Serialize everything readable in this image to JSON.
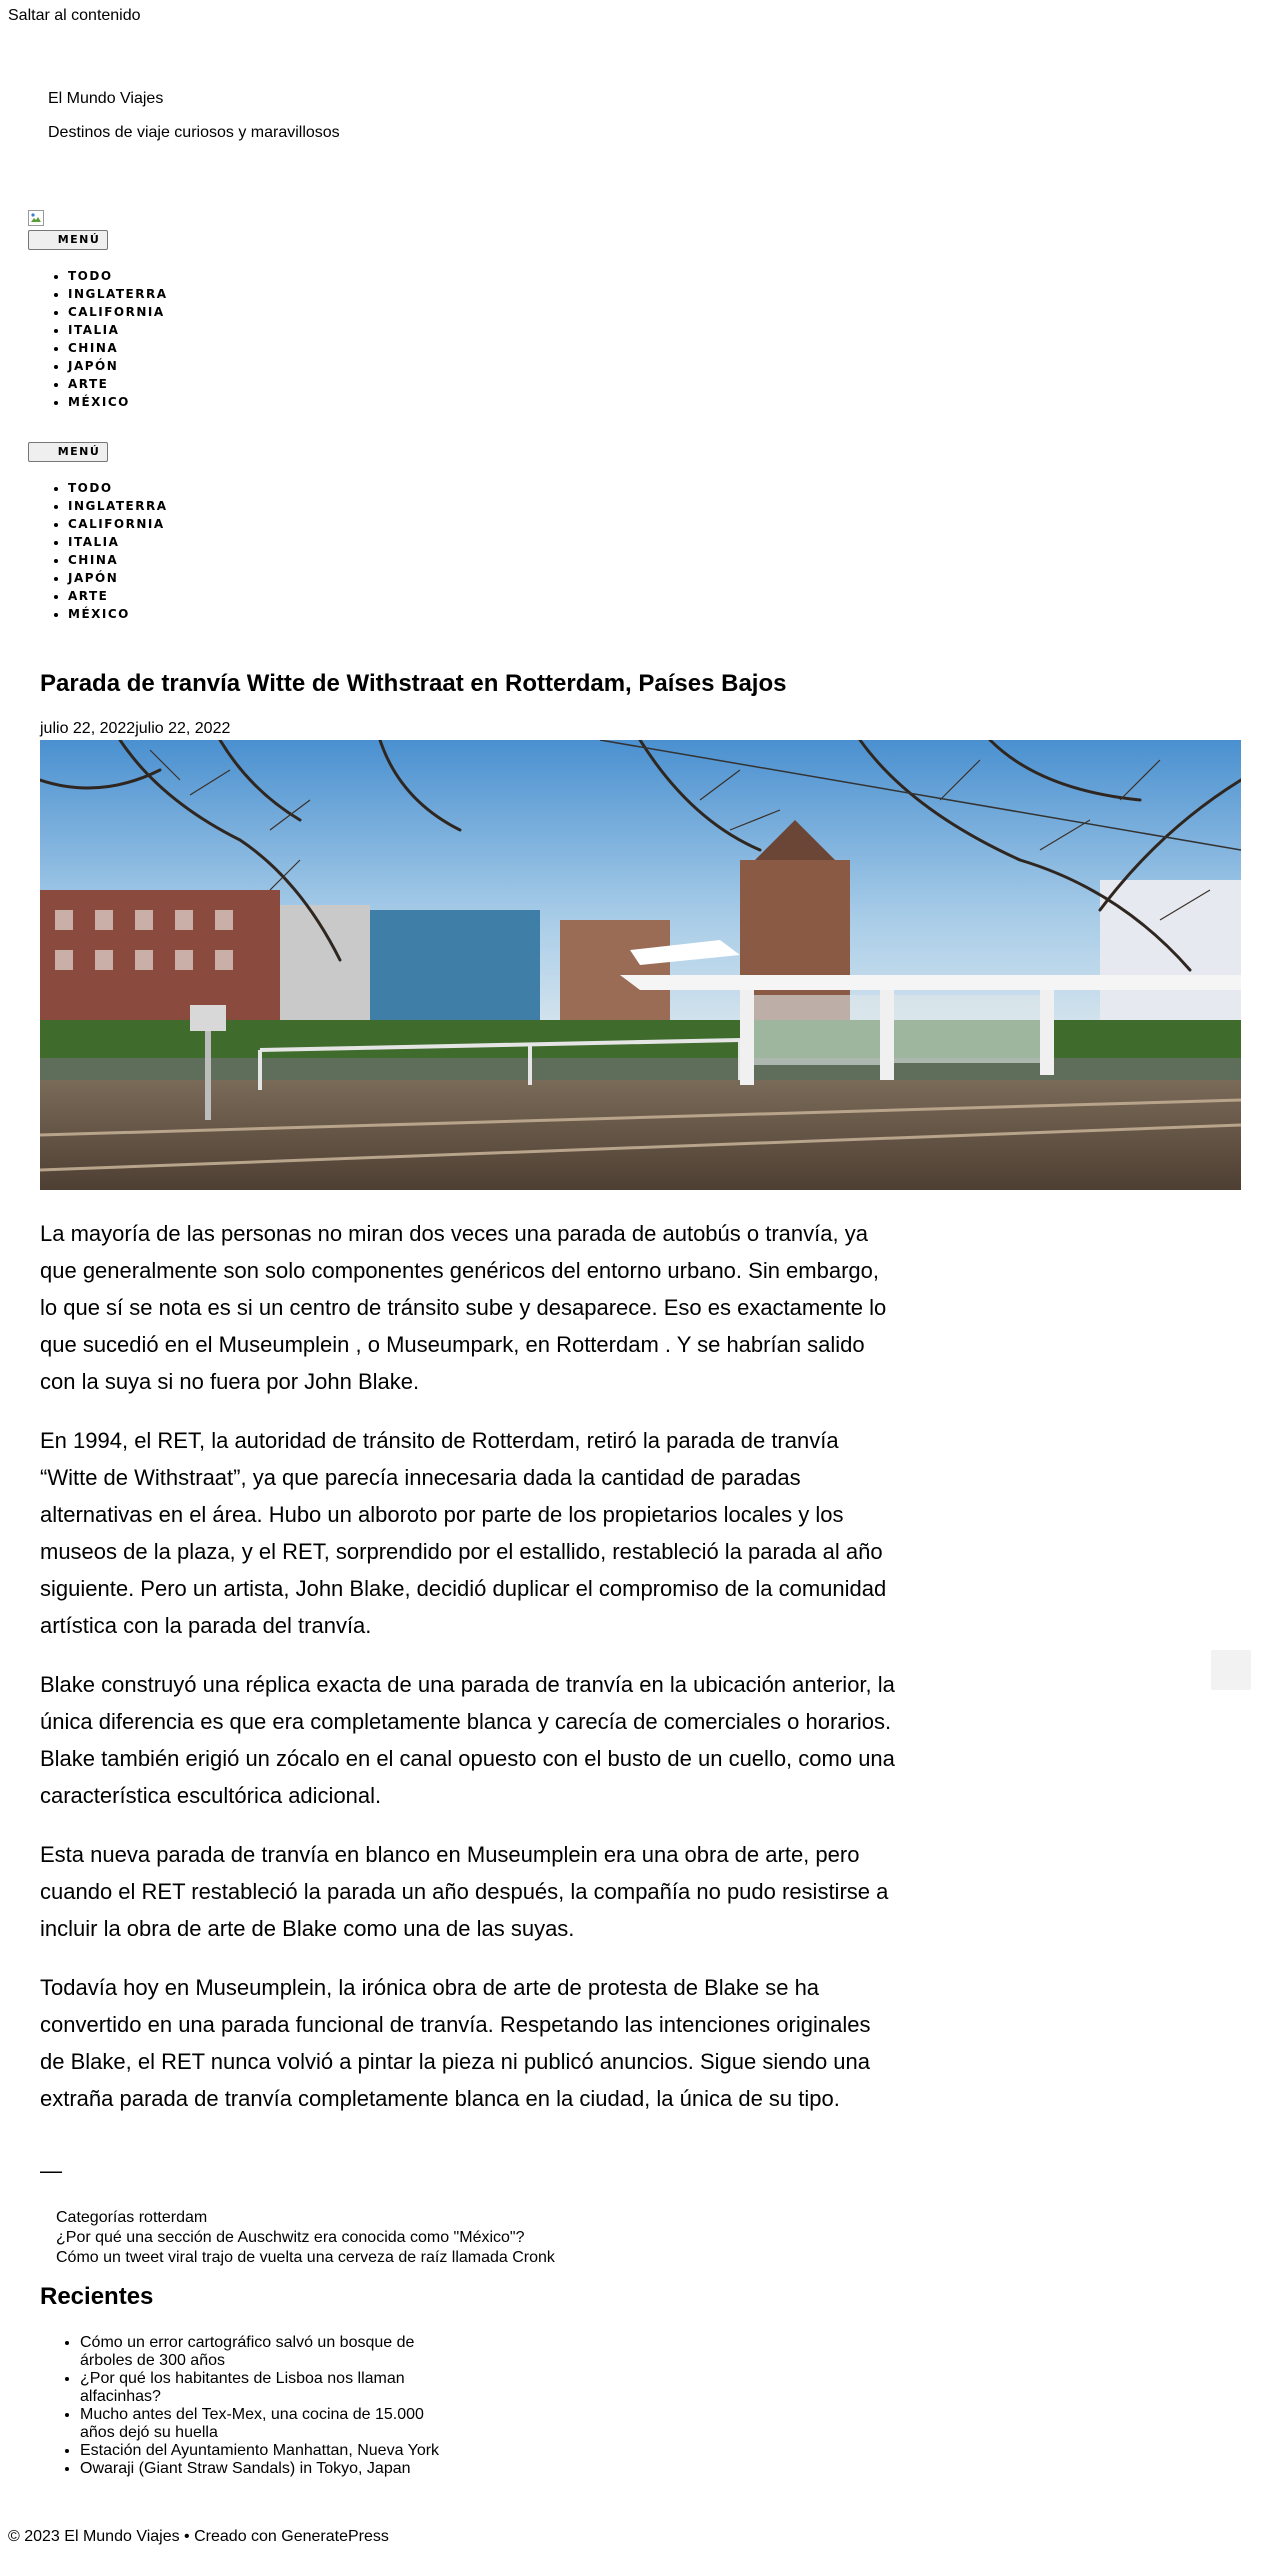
{
  "skip_link": "Saltar al contenido",
  "site": {
    "title": "El Mundo Viajes",
    "description": "Destinos de viaje curiosos y maravillosos"
  },
  "menu": {
    "toggle_label": "MENÚ",
    "items": [
      "TODO",
      "INGLATERRA",
      "CALIFORNIA",
      "ITALIA",
      "CHINA",
      "JAPÓN",
      "ARTE",
      "MÉXICO"
    ]
  },
  "post": {
    "title": "Parada de tranvía Witte de Withstraat en Rotterdam, Países Bajos",
    "date": "julio 22, 2022julio 22, 2022",
    "paragraphs": [
      "La mayoría de las personas no miran dos veces una parada de autobús o tranvía, ya que generalmente son solo componentes genéricos del entorno urbano. Sin embargo, lo que sí se nota es si un centro de tránsito sube y desaparece. Eso es exactamente lo que sucedió en el Museumplein , o Museumpark, en Rotterdam . Y se habrían salido con la suya si no fuera por John Blake.",
      "En 1994, el RET, la autoridad de tránsito de Rotterdam, retiró la parada de tranvía “Witte de Withstraat”, ya que parecía innecesaria dada la cantidad de paradas alternativas en el área. Hubo un alboroto por parte de los propietarios locales y los museos de la plaza, y el RET, sorprendido por el estallido, restableció la parada al año siguiente. Pero un artista, John Blake, decidió duplicar el compromiso de la comunidad artística con la parada del tranvía.",
      "Blake construyó una réplica exacta de una parada de tranvía en la ubicación anterior, la única diferencia es que era completamente blanca y carecía de comerciales o horarios. Blake también erigió un zócalo en el canal opuesto con el busto de un cuello, como una característica escultórica adicional.",
      "Esta nueva parada de tranvía en blanco en Museumplein era una obra de arte, pero cuando el RET restableció la parada un año después, la compañía no pudo resistirse a incluir la obra de arte de Blake como una de las suyas.",
      "Todavía hoy en Museumplein, la irónica obra de arte de protesta de Blake se ha convertido en una parada funcional de tranvía. Respetando las intenciones originales de Blake, el RET nunca volvió a pintar la pieza ni publicó anuncios. Sigue siendo una extraña parada de tranvía completamente blanca en la ciudad, la única de su tipo."
    ],
    "separator": "—",
    "categories_label": "Categorías",
    "category": "rotterdam",
    "prev_post": "¿Por qué una sección de Auschwitz era conocida como \"México\"?",
    "next_post": "Cómo un tweet viral trajo de vuelta una cerveza de raíz llamada Cronk"
  },
  "recent": {
    "heading": "Recientes",
    "items": [
      "Cómo un error cartográfico salvó un bosque de árboles de 300 años",
      "¿Por qué los habitantes de Lisboa nos llaman alfacinhas?",
      "Mucho antes del Tex-Mex, una cocina de 15.000 años dejó su huella",
      "Estación del Ayuntamiento Manhattan, Nueva York",
      "Owaraji (Giant Straw Sandals) in Tokyo, Japan"
    ]
  },
  "footer": {
    "copyright": "© 2023 El Mundo Viajes",
    "separator": " • ",
    "credit_prefix": "Creado con ",
    "credit_link": "GeneratePress"
  }
}
